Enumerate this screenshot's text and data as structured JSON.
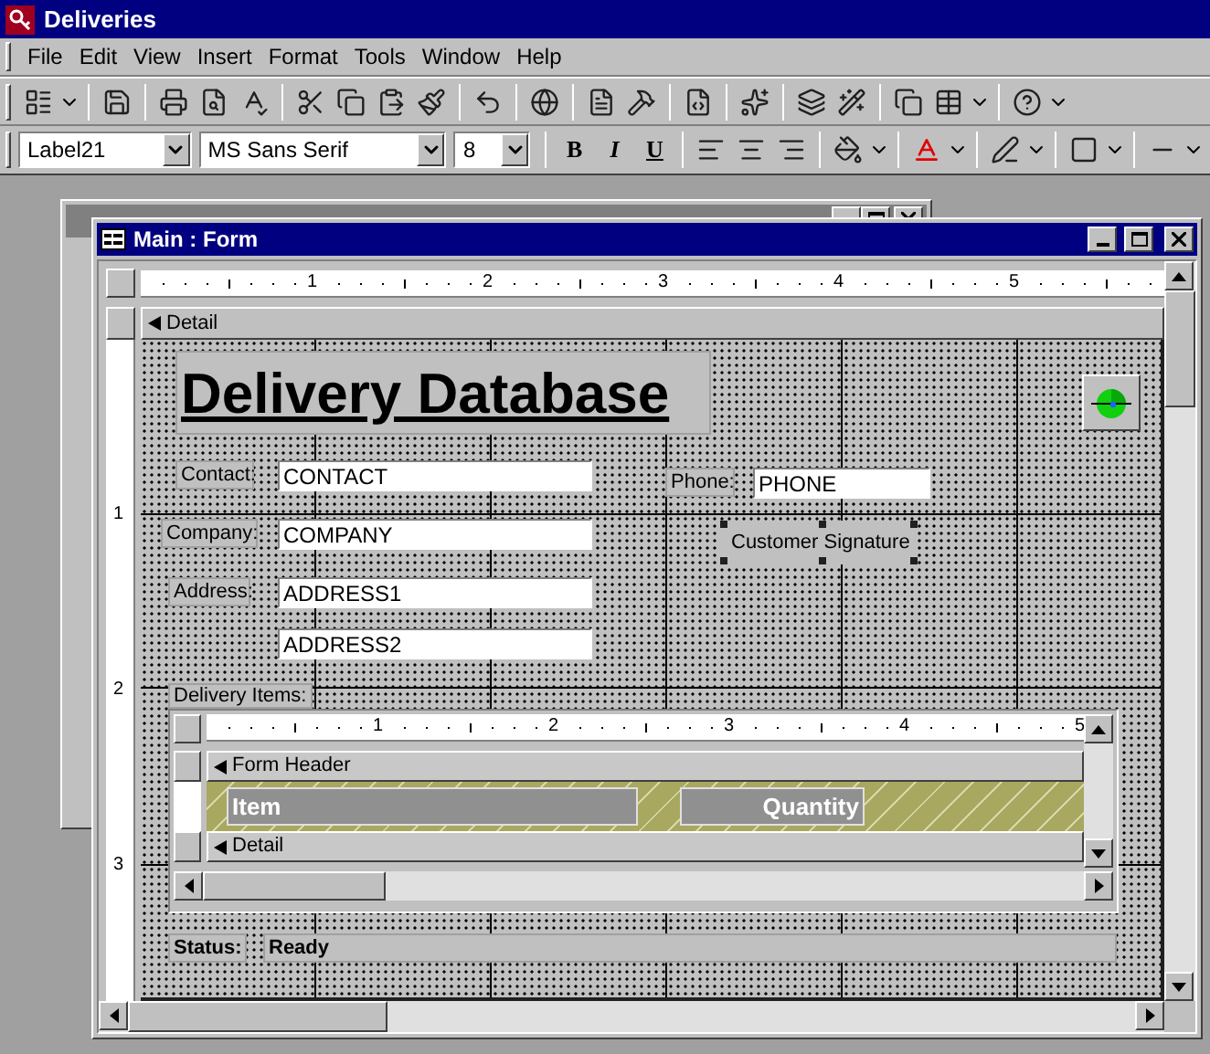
{
  "app_window": {
    "title": "Deliveries"
  },
  "menu": [
    "File",
    "Edit",
    "View",
    "Insert",
    "Format",
    "Tools",
    "Window",
    "Help"
  ],
  "formatting_toolbar": {
    "object": "Label21",
    "font": "MS Sans Serif",
    "size": "8",
    "bold": "B",
    "italic": "I",
    "underline": "U"
  },
  "form_window": {
    "title": "Main : Form"
  },
  "ruler_marks": [
    "1",
    "2",
    "3",
    "4",
    "5"
  ],
  "vertical_ruler_marks": [
    "1",
    "2",
    "3"
  ],
  "detail_section": "Detail",
  "controls": [
    {
      "kind": "heading",
      "text": "Delivery Database",
      "selected": false
    },
    {
      "kind": "button",
      "selected": false
    },
    {
      "kind": "label",
      "text": "Contact:",
      "selected": false
    },
    {
      "kind": "textbox",
      "text": "CONTACT",
      "selected": false
    },
    {
      "kind": "label",
      "text": "Phone:",
      "selected": false
    },
    {
      "kind": "textbox",
      "text": "PHONE",
      "selected": false
    },
    {
      "kind": "label",
      "text": "Company:",
      "selected": false
    },
    {
      "kind": "textbox",
      "text": "COMPANY",
      "selected": false
    },
    {
      "kind": "label",
      "text": "Customer Signature",
      "selected": true
    },
    {
      "kind": "label",
      "text": "Address:",
      "selected": false
    },
    {
      "kind": "textbox",
      "text": "ADDRESS1",
      "selected": false
    },
    {
      "kind": "textbox",
      "text": "ADDRESS2",
      "selected": false
    }
  ],
  "subform": {
    "label": "Delivery Items:",
    "ruler_marks": [
      "1",
      "2",
      "3",
      "4",
      "5"
    ],
    "header_section": "Form Header",
    "columns": [
      "Item",
      "Quantity"
    ],
    "detail_section": "Detail"
  },
  "status": {
    "label": "Status:",
    "value": "Ready"
  }
}
